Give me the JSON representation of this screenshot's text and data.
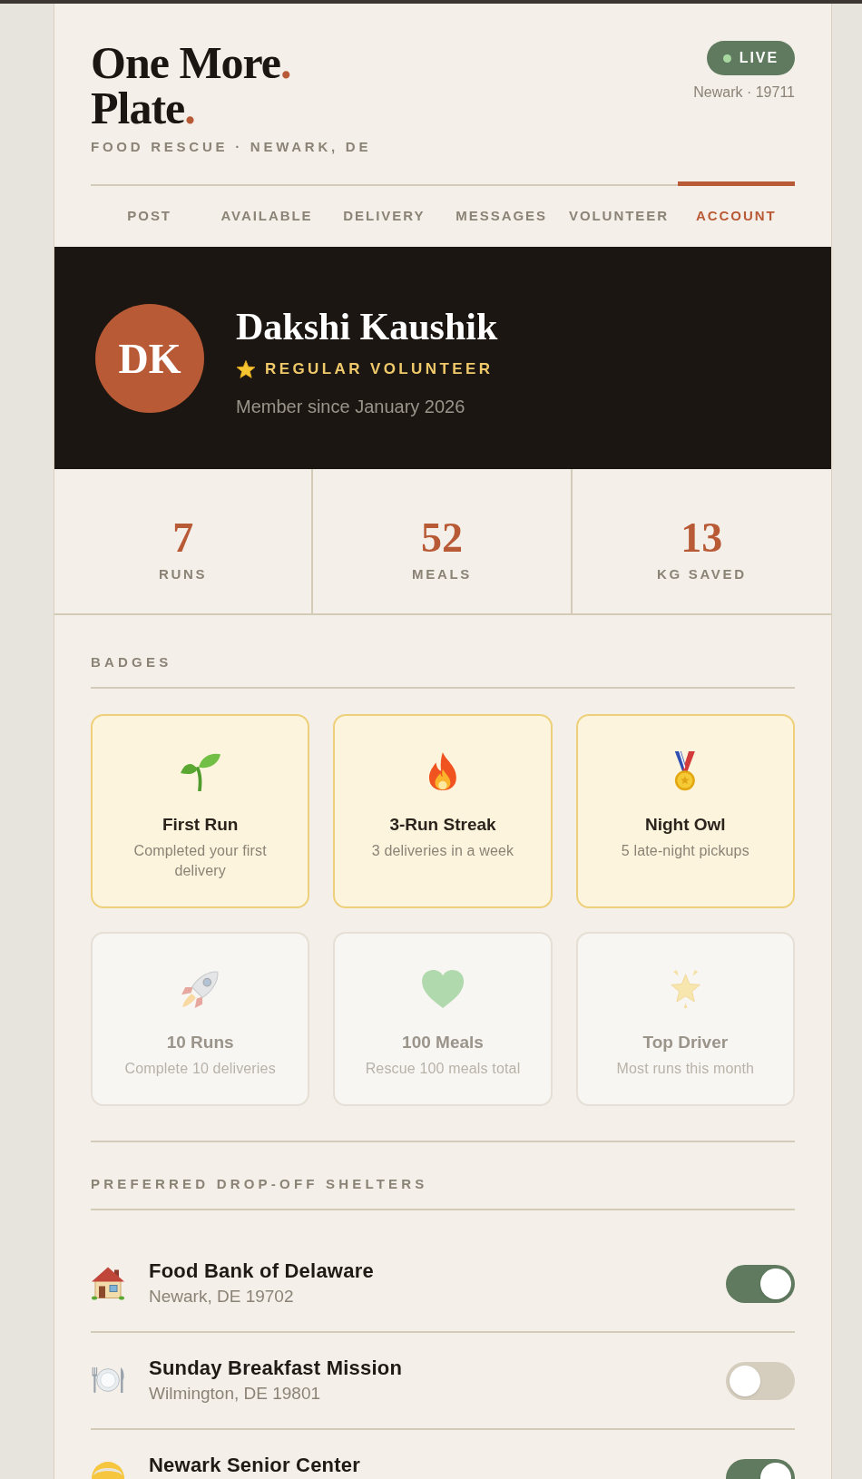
{
  "header": {
    "logo": [
      {
        "text": "One More",
        "accent": "."
      },
      {
        "text": "Plate",
        "accent": "."
      }
    ],
    "tagline": "FOOD RESCUE · NEWARK, DE",
    "status": {
      "label": "LIVE"
    },
    "location": "Newark · 19711"
  },
  "tabs": [
    {
      "label": "POST",
      "selected": false
    },
    {
      "label": "AVAILABLE",
      "selected": false
    },
    {
      "label": "DELIVERY",
      "selected": false
    },
    {
      "label": "MESSAGES",
      "selected": false
    },
    {
      "label": "VOLUNTEER",
      "selected": false
    },
    {
      "label": "ACCOUNT",
      "selected": true
    }
  ],
  "profile": {
    "initials": "DK",
    "name": "Dakshi Kaushik",
    "role": "REGULAR VOLUNTEER",
    "member_since": "Member since January 2026"
  },
  "stats": [
    {
      "value": "7",
      "label": "RUNS"
    },
    {
      "value": "52",
      "label": "MEALS"
    },
    {
      "value": "13",
      "label": "KG SAVED"
    }
  ],
  "badges": {
    "heading": "BADGES",
    "items": [
      {
        "title": "First Run",
        "description": "Completed your first delivery",
        "earned": true
      },
      {
        "title": "3-Run Streak",
        "description": "3 deliveries in a week",
        "earned": true
      },
      {
        "title": "Night Owl",
        "description": "5 late-night pickups",
        "earned": true
      },
      {
        "title": "10 Runs",
        "description": "Complete 10 deliveries",
        "earned": false
      },
      {
        "title": "100 Meals",
        "description": "Rescue 100 meals total",
        "earned": false
      },
      {
        "title": "Top Driver",
        "description": "Most runs this month",
        "earned": false
      }
    ]
  },
  "shelters": {
    "heading": "PREFERRED DROP-OFF SHELTERS",
    "items": [
      {
        "name": "Food Bank of Delaware",
        "address": "Newark, DE 19702",
        "on": true
      },
      {
        "name": "Sunday Breakfast Mission",
        "address": "Wilmington, DE 19801",
        "on": false
      },
      {
        "name": "Newark Senior Center",
        "on": true
      }
    ]
  }
}
